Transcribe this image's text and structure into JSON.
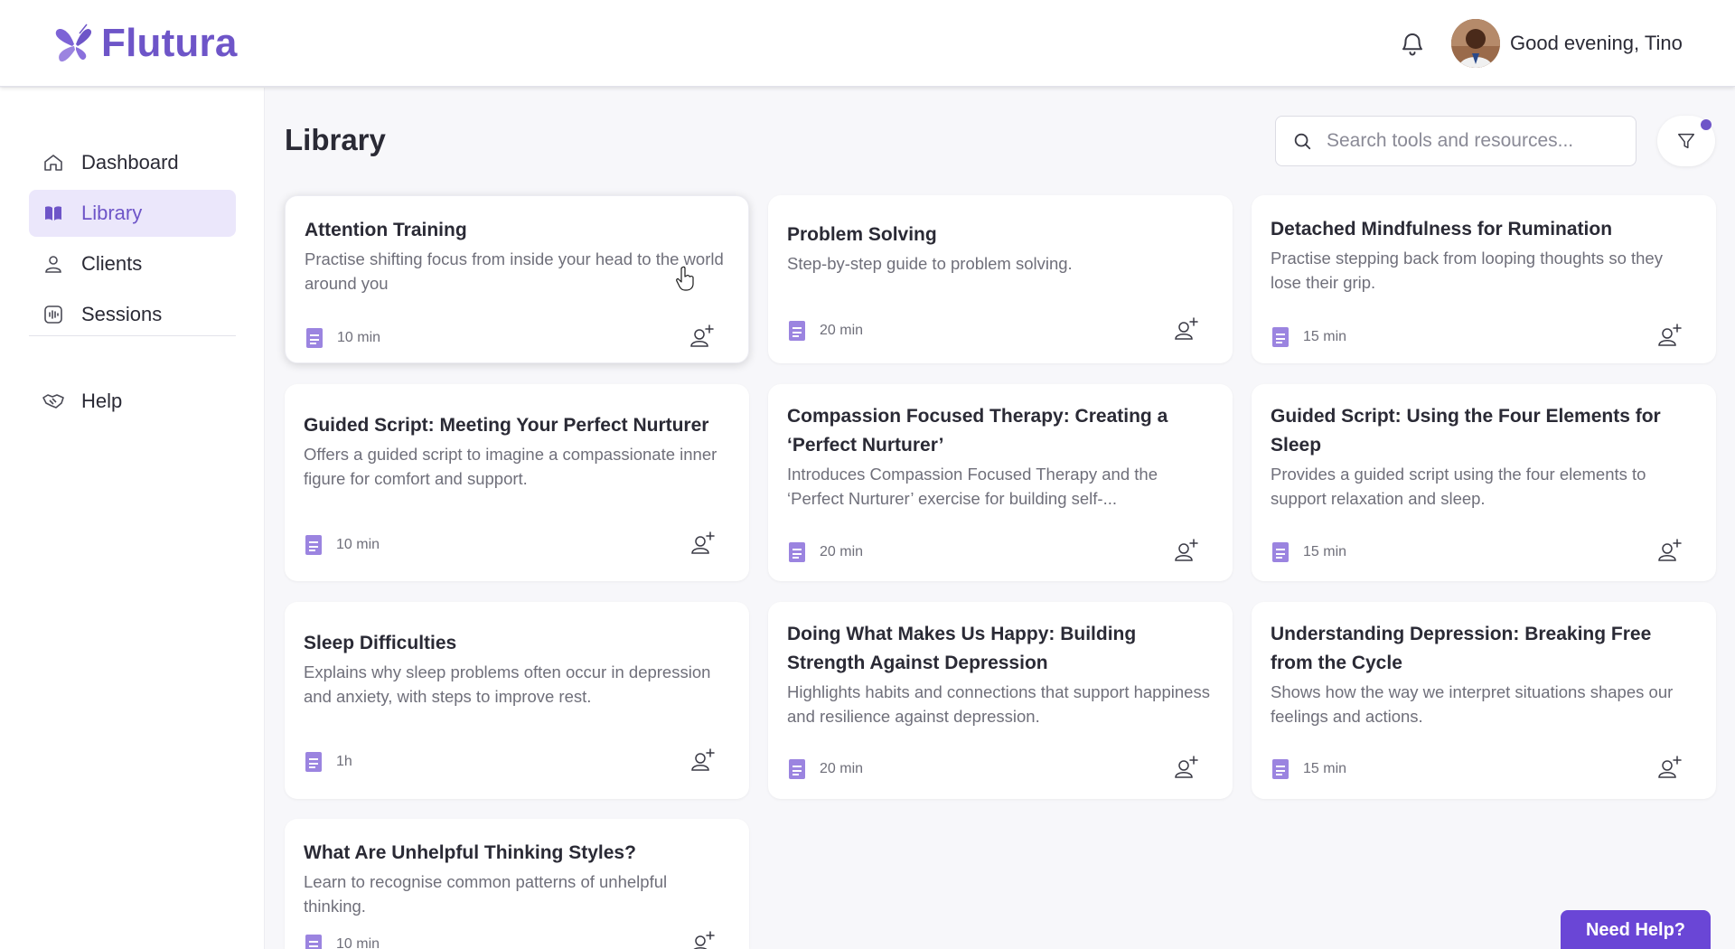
{
  "app": {
    "name": "Flutura",
    "brand_color": "#6e55c8"
  },
  "header": {
    "greeting": "Good evening, Tino",
    "icons": [
      "bell-icon",
      "avatar"
    ]
  },
  "sidebar": {
    "items": [
      {
        "label": "Dashboard",
        "icon": "home-icon",
        "active": false
      },
      {
        "label": "Library",
        "icon": "book-icon",
        "active": true
      },
      {
        "label": "Clients",
        "icon": "user-icon",
        "active": false
      },
      {
        "label": "Sessions",
        "icon": "audio-wave-icon",
        "active": false
      },
      {
        "label": "Help",
        "icon": "handshake-icon",
        "active": false
      }
    ]
  },
  "main": {
    "title": "Library",
    "search": {
      "placeholder": "Search tools and resources...",
      "value": ""
    },
    "cards": [
      {
        "title": "Attention Training",
        "description": "Practise shifting focus from inside your head to the world around you",
        "duration": "10 min"
      },
      {
        "title": "Problem Solving",
        "description": "Step-by-step guide to problem solving.",
        "duration": "20 min"
      },
      {
        "title": "Detached Mindfulness for Rumination",
        "description": "Practise stepping back from looping thoughts so they lose their grip.",
        "duration": "15 min"
      },
      {
        "title": "Guided Script: Meeting Your Perfect Nurturer",
        "description": "Offers a guided script to imagine a compassionate inner figure for comfort and support.",
        "duration": "10 min"
      },
      {
        "title": "Compassion Focused Therapy: Creating a ‘Perfect Nurturer’",
        "description": "Introduces Compassion Focused Therapy and the ‘Perfect Nurturer’ exercise for building self-...",
        "duration": "20 min"
      },
      {
        "title": "Guided Script: Using the Four Elements for Sleep",
        "description": "Provides a guided script using the four elements to support relaxation and sleep.",
        "duration": "15 min"
      },
      {
        "title": "Sleep Difficulties",
        "description": "Explains why sleep problems often occur in depression and anxiety, with steps to improve rest.",
        "duration": "1h"
      },
      {
        "title": "Doing What Makes Us Happy: Building Strength Against Depression",
        "description": "Highlights habits and connections that support happiness and resilience against depression.",
        "duration": "20 min"
      },
      {
        "title": "Understanding Depression: Breaking Free from the Cycle",
        "description": "Shows how the way we interpret situations shapes our feelings and actions.",
        "duration": "15 min"
      },
      {
        "title": "What Are Unhelpful Thinking Styles?",
        "description": "Learn to recognise common patterns of unhelpful thinking.",
        "duration": "10 min"
      }
    ]
  },
  "help_button": {
    "label": "Need Help?"
  }
}
